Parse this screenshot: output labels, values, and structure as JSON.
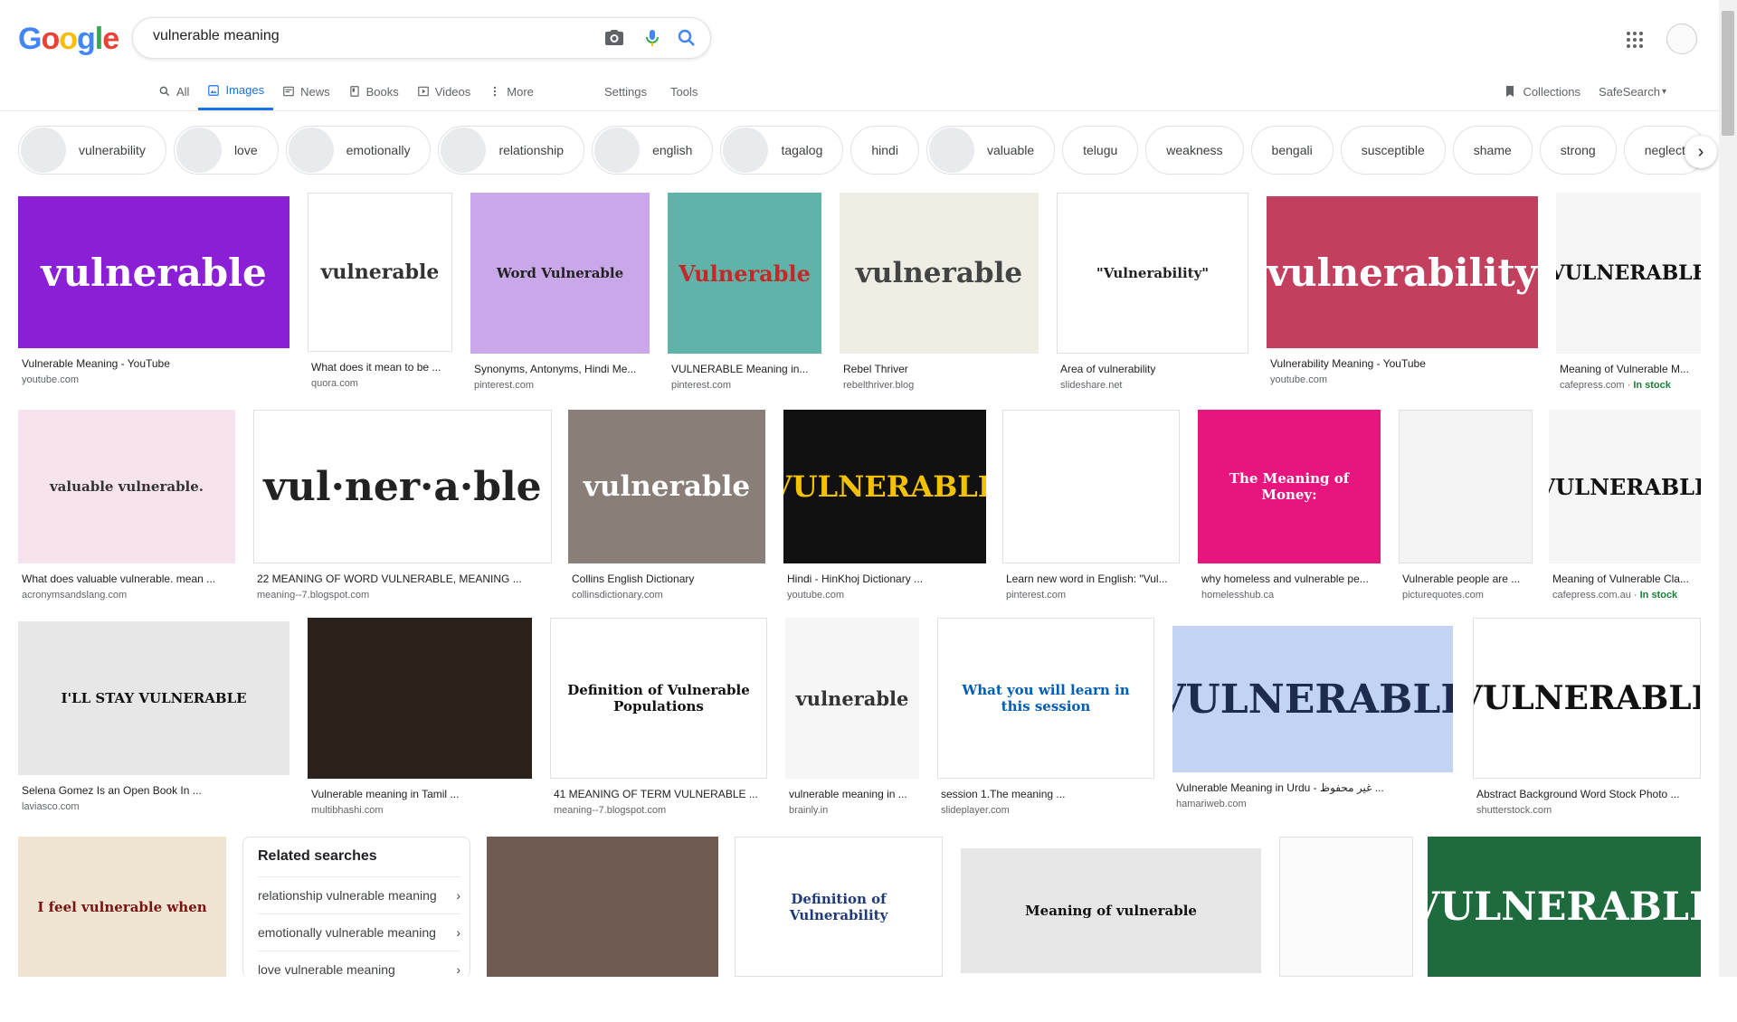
{
  "search": {
    "query": "vulnerable meaning"
  },
  "tabs": [
    {
      "label": "All",
      "icon": "search-icon"
    },
    {
      "label": "Images",
      "icon": "image-icon",
      "active": true
    },
    {
      "label": "News",
      "icon": "news-icon"
    },
    {
      "label": "Books",
      "icon": "book-icon"
    },
    {
      "label": "Videos",
      "icon": "video-icon"
    },
    {
      "label": "More",
      "icon": "more-vert-icon"
    }
  ],
  "tools": {
    "settings": "Settings",
    "tools": "Tools"
  },
  "right": {
    "collections": "Collections",
    "safesearch": "SafeSearch"
  },
  "chips": [
    {
      "label": "vulnerability",
      "thumb": true
    },
    {
      "label": "love",
      "thumb": true
    },
    {
      "label": "emotionally",
      "thumb": true
    },
    {
      "label": "relationship",
      "thumb": true
    },
    {
      "label": "english",
      "thumb": true
    },
    {
      "label": "tagalog",
      "thumb": true
    },
    {
      "label": "hindi",
      "thumb": false
    },
    {
      "label": "valuable",
      "thumb": true
    },
    {
      "label": "telugu",
      "thumb": false
    },
    {
      "label": "weakness",
      "thumb": false
    },
    {
      "label": "bengali",
      "thumb": false
    },
    {
      "label": "susceptible",
      "thumb": false
    },
    {
      "label": "shame",
      "thumb": false
    },
    {
      "label": "strong",
      "thumb": false
    },
    {
      "label": "neglect",
      "thumb": false
    }
  ],
  "results": [
    {
      "img_text": "vulnerable",
      "caption": "Vulnerable Meaning - YouTube",
      "source": "youtube.com",
      "bg": "#8a1fd6",
      "fg": "#ffffff"
    },
    {
      "img_text": "vulnerable",
      "caption": "What does it mean to be ...",
      "source": "quora.com",
      "bg": "#ffffff",
      "fg": "#333333"
    },
    {
      "img_text": "Word Vulnerable",
      "caption": "Synonyms, Antonyms, Hindi Me...",
      "source": "pinterest.com",
      "bg": "#c9a7e8",
      "fg": "#222222"
    },
    {
      "img_text": "Vulnerable",
      "caption": "VULNERABLE Meaning in...",
      "source": "pinterest.com",
      "bg": "#5fb3a8",
      "fg": "#c62828"
    },
    {
      "img_text": "vulnerable",
      "caption": "Rebel Thriver",
      "source": "rebelthriver.blog",
      "bg": "#efeee4",
      "fg": "#444444"
    },
    {
      "img_text": "\"Vulnerability\"",
      "caption": "Area of vulnerability",
      "source": "slideshare.net",
      "bg": "#ffffff",
      "fg": "#222222"
    },
    {
      "img_text": "vulnerability",
      "caption": "Vulnerability Meaning - YouTube",
      "source": "youtube.com",
      "bg": "#c2405e",
      "fg": "#ffffff"
    },
    {
      "img_text": "VULNERABLE",
      "caption": "Meaning of Vulnerable M...",
      "source": "cafepress.com",
      "stock": "In stock",
      "bg": "#f5f5f5",
      "fg": "#111111"
    },
    {
      "img_text": "valuable vulnerable.",
      "caption": "What does valuable vulnerable. mean ...",
      "source": "acronymsandslang.com",
      "bg": "#f7e3ee",
      "fg": "#333333"
    },
    {
      "img_text": "vul·ner·a·ble",
      "caption": "22 MEANING OF WORD VULNERABLE, MEANING ...",
      "source": "meaning--7.blogspot.com",
      "bg": "#ffffff",
      "fg": "#222222"
    },
    {
      "img_text": "vulnerable",
      "caption": "Collins English Dictionary",
      "source": "collinsdictionary.com",
      "bg": "#8a7f78",
      "fg": "#ffffff"
    },
    {
      "img_text": "VULNERABLE",
      "caption": "Hindi - HinKhoj Dictionary ...",
      "source": "youtube.com",
      "bg": "#111111",
      "fg": "#f2c200"
    },
    {
      "img_text": "",
      "caption": "Learn new word in English: \"Vul...",
      "source": "pinterest.com",
      "bg": "#ffffff",
      "fg": "#222222"
    },
    {
      "img_text": "The Meaning of Money:",
      "caption": "why homeless and vulnerable pe...",
      "source": "homelesshub.ca",
      "bg": "#e8157f",
      "fg": "#ffffff"
    },
    {
      "img_text": "",
      "caption": "Vulnerable people are ...",
      "source": "picturequotes.com",
      "bg": "#f4f4f4",
      "fg": "#555555"
    },
    {
      "img_text": "VULNERABLE",
      "caption": "Meaning of Vulnerable Cla...",
      "source": "cafepress.com.au",
      "stock": "In stock",
      "bg": "#f5f5f5",
      "fg": "#111111"
    },
    {
      "img_text": "I'LL STAY VULNERABLE",
      "caption": "Selena Gomez Is an Open Book In ...",
      "source": "laviasco.com",
      "bg": "#e7e7e7",
      "fg": "#111111"
    },
    {
      "img_text": "",
      "caption": "Vulnerable meaning in Tamil ...",
      "source": "multibhashi.com",
      "bg": "#2a211b",
      "fg": "#ffffff"
    },
    {
      "img_text": "Definition of Vulnerable Populations",
      "caption": "41 MEANING OF TERM VULNERABLE ...",
      "source": "meaning--7.blogspot.com",
      "bg": "#ffffff",
      "fg": "#111111"
    },
    {
      "img_text": "vulnerable",
      "caption": "vulnerable meaning in ...",
      "source": "brainly.in",
      "bg": "#f6f6f6",
      "fg": "#333333"
    },
    {
      "img_text": "What you will learn in this session",
      "caption": "session 1.The meaning ...",
      "source": "slideplayer.com",
      "bg": "#ffffff",
      "fg": "#005eb8"
    },
    {
      "img_text": "VULNERABLE",
      "caption": "Vulnerable Meaning in Urdu - غیر محفوظ ...",
      "source": "hamariweb.com",
      "bg": "#c3d3f3",
      "fg": "#1d2b4f"
    },
    {
      "img_text": "VULNERABLE",
      "caption": "Abstract Background Word Stock Photo ...",
      "source": "shutterstock.com",
      "bg": "#ffffff",
      "fg": "#111111"
    },
    {
      "img_text": "I feel vulnerable when",
      "caption": "",
      "source": "",
      "bg": "#efe3d2",
      "fg": "#7a1414"
    },
    {
      "img_text": "",
      "caption": "",
      "source": "",
      "bg": "#6e5a50",
      "fg": "#ffffff"
    },
    {
      "img_text": "Definition of Vulnerability",
      "caption": "",
      "source": "",
      "bg": "#ffffff",
      "fg": "#1f3a7a"
    },
    {
      "img_text": "Meaning of vulnerable",
      "caption": "",
      "source": "",
      "bg": "#e6e6e6",
      "fg": "#111111"
    },
    {
      "img_text": "",
      "caption": "",
      "source": "",
      "bg": "#fafafa",
      "fg": "#444444"
    },
    {
      "img_text": "VULNERABLE",
      "caption": "",
      "source": "",
      "bg": "#1e6b3e",
      "fg": "#ffffff"
    }
  ],
  "related": {
    "title": "Related searches",
    "items": [
      "relationship vulnerable meaning",
      "emotionally vulnerable meaning",
      "love vulnerable meaning"
    ]
  }
}
